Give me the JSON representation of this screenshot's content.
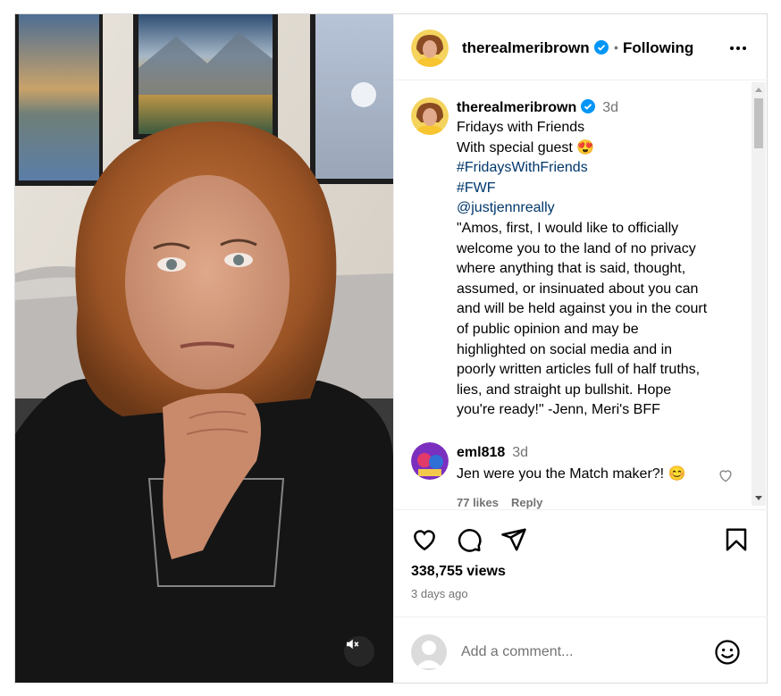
{
  "post": {
    "author": "therealmeribrown",
    "follow_separator": "•",
    "follow_status": "Following",
    "icons": {
      "verified": "verified-badge-icon",
      "more": "more-options-icon",
      "mute": "muted-speaker-icon"
    }
  },
  "caption": {
    "username": "therealmeribrown",
    "time": "3d",
    "lines": [
      "Fridays with Friends",
      "With special guest 😍",
      "#FridaysWithFriends",
      "#FWF",
      "@justjennreally",
      "\"Amos, first, I would like to officially",
      "welcome you to the land of no privacy",
      "where anything that is said, thought,",
      "assumed, or insinuated about you can",
      "and will be held against you in the court",
      "of public opinion and may be",
      "highlighted on social media and in",
      "poorly written articles full of half truths,",
      "lies, and straight up bullshit. Hope",
      "you're ready!\" -Jenn, Meri's BFF"
    ]
  },
  "comment": {
    "username": "eml818",
    "time": "3d",
    "text": "Jen were you the Match maker?! 😊",
    "likes": "77 likes",
    "reply": "Reply"
  },
  "actions": {
    "icons": [
      "like-heart-icon",
      "comment-icon",
      "share-icon",
      "save-bookmark-icon"
    ],
    "views": "338,755 views",
    "posted": "3 days ago"
  },
  "add_comment": {
    "placeholder": "Add a comment...",
    "emoji_icon": "emoji-smiley-icon"
  },
  "colors": {
    "link": "#00376b",
    "verified": "#0095f6",
    "muted_text": "#737373",
    "border": "#dbdbdb"
  }
}
